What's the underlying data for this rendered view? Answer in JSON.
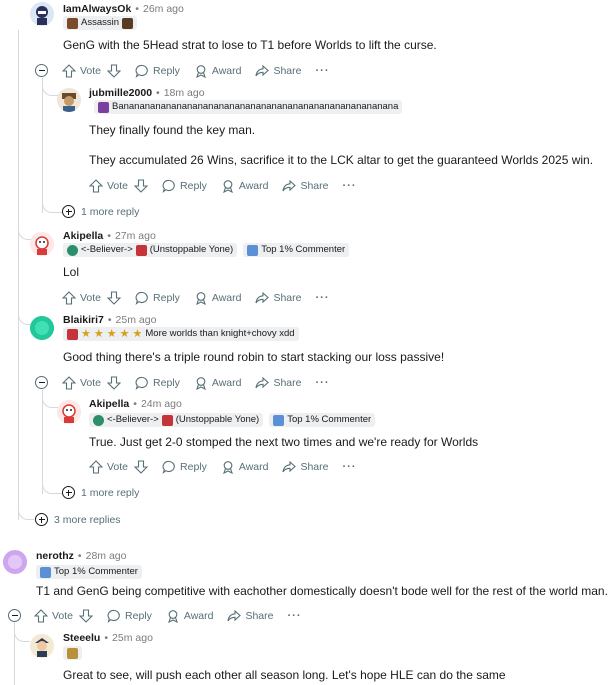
{
  "actions": {
    "vote": "Vote",
    "reply": "Reply",
    "award": "Award",
    "share": "Share",
    "more": "···"
  },
  "comments": [
    {
      "username": "IamAlwaysOk",
      "time": "26m ago",
      "flair": "Assassin",
      "body": "GenG with the 5Head strat to lose to T1 before Worlds to lift the curse."
    },
    {
      "username": "jubmille2000",
      "time": "18m ago",
      "flair": "Banananananananananananananananananananananananananana",
      "body_lines": [
        "They finally found the key man.",
        "They accumulated 26 Wins, sacrifice it to the LCK altar to get the guaranteed Worlds 2025 win."
      ]
    },
    {
      "username": "Akipella",
      "time": "27m ago",
      "flair": "<-Believer->",
      "flair_extra": "(Unstoppable Yone)",
      "badge": "Top 1% Commenter",
      "body": "Lol"
    },
    {
      "username": "Blaikiri7",
      "time": "25m ago",
      "flair": "More worlds than knight+chovy xdd",
      "body": "Good thing there's a triple round robin to start stacking our loss passive!"
    },
    {
      "username": "Akipella",
      "time": "24m ago",
      "flair": "<-Believer->",
      "flair_extra": "(Unstoppable Yone)",
      "badge": "Top 1% Commenter",
      "body": "True. Just get 2-0 stomped the next two times and we're ready for Worlds"
    },
    {
      "username": "nerothz",
      "time": "28m ago",
      "badge": "Top 1% Commenter",
      "body": "T1 and GenG being competitive with eachother domestically doesn't bode well for the rest of the world man."
    },
    {
      "username": "Steeelu",
      "time": "25m ago",
      "body": "Great to see, will push each other all season long. Let's hope HLE can do the same"
    }
  ],
  "more_replies": {
    "first": "1 more reply",
    "second": "1 more reply",
    "third": "3 more replies"
  },
  "colors": {
    "meta": "#7c7c7c",
    "action": "#576f76",
    "flair_bg": "#edeff1",
    "thread": "#d6d9dc"
  }
}
